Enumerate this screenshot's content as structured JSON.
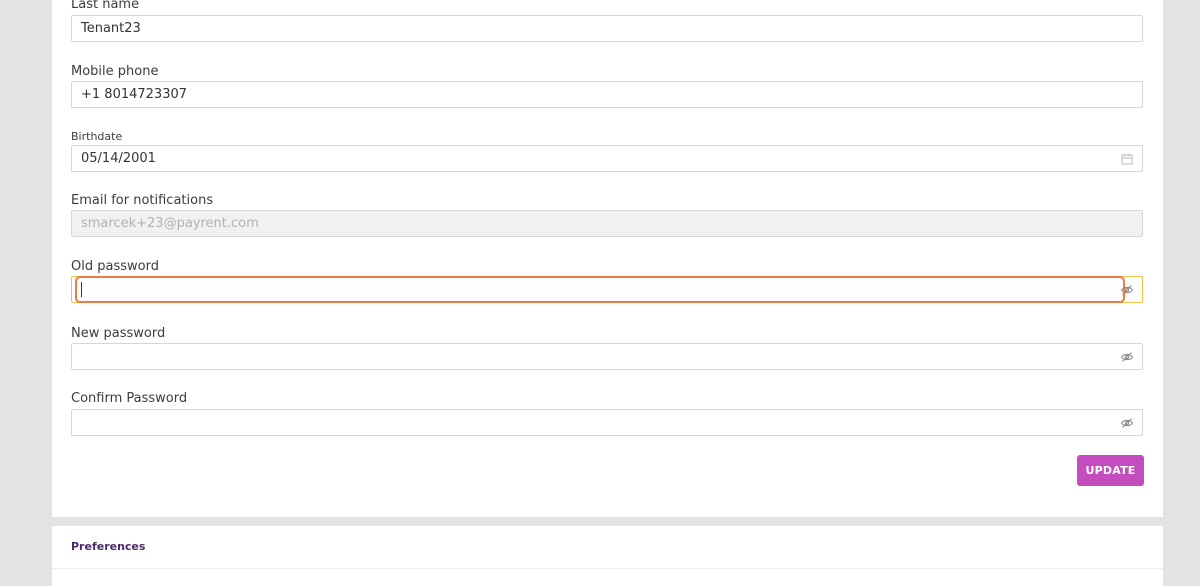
{
  "profile": {
    "last_name": {
      "label": "Last name",
      "value": "Tenant23"
    },
    "mobile_phone": {
      "label": "Mobile phone",
      "value": "+1 8014723307"
    },
    "birthdate": {
      "label": "Birthdate",
      "value": "05/14/2001",
      "icon": "calendar-icon"
    },
    "email": {
      "label": "Email for notifications",
      "value": "smarcek+23@payrent.com"
    },
    "old_password": {
      "label": "Old password",
      "value": "",
      "icon": "eye-slash-icon"
    },
    "new_password": {
      "label": "New password",
      "value": "",
      "icon": "eye-slash-icon"
    },
    "confirm_password": {
      "label": "Confirm Password",
      "value": "",
      "icon": "eye-slash-icon"
    },
    "update_label": "UPDATE"
  },
  "preferences": {
    "title": "Preferences"
  },
  "colors": {
    "accent": "#c44cbf",
    "focus_ring": "#ee7a43",
    "focus_border": "#f6c24a",
    "heading": "#4a2a6b"
  }
}
